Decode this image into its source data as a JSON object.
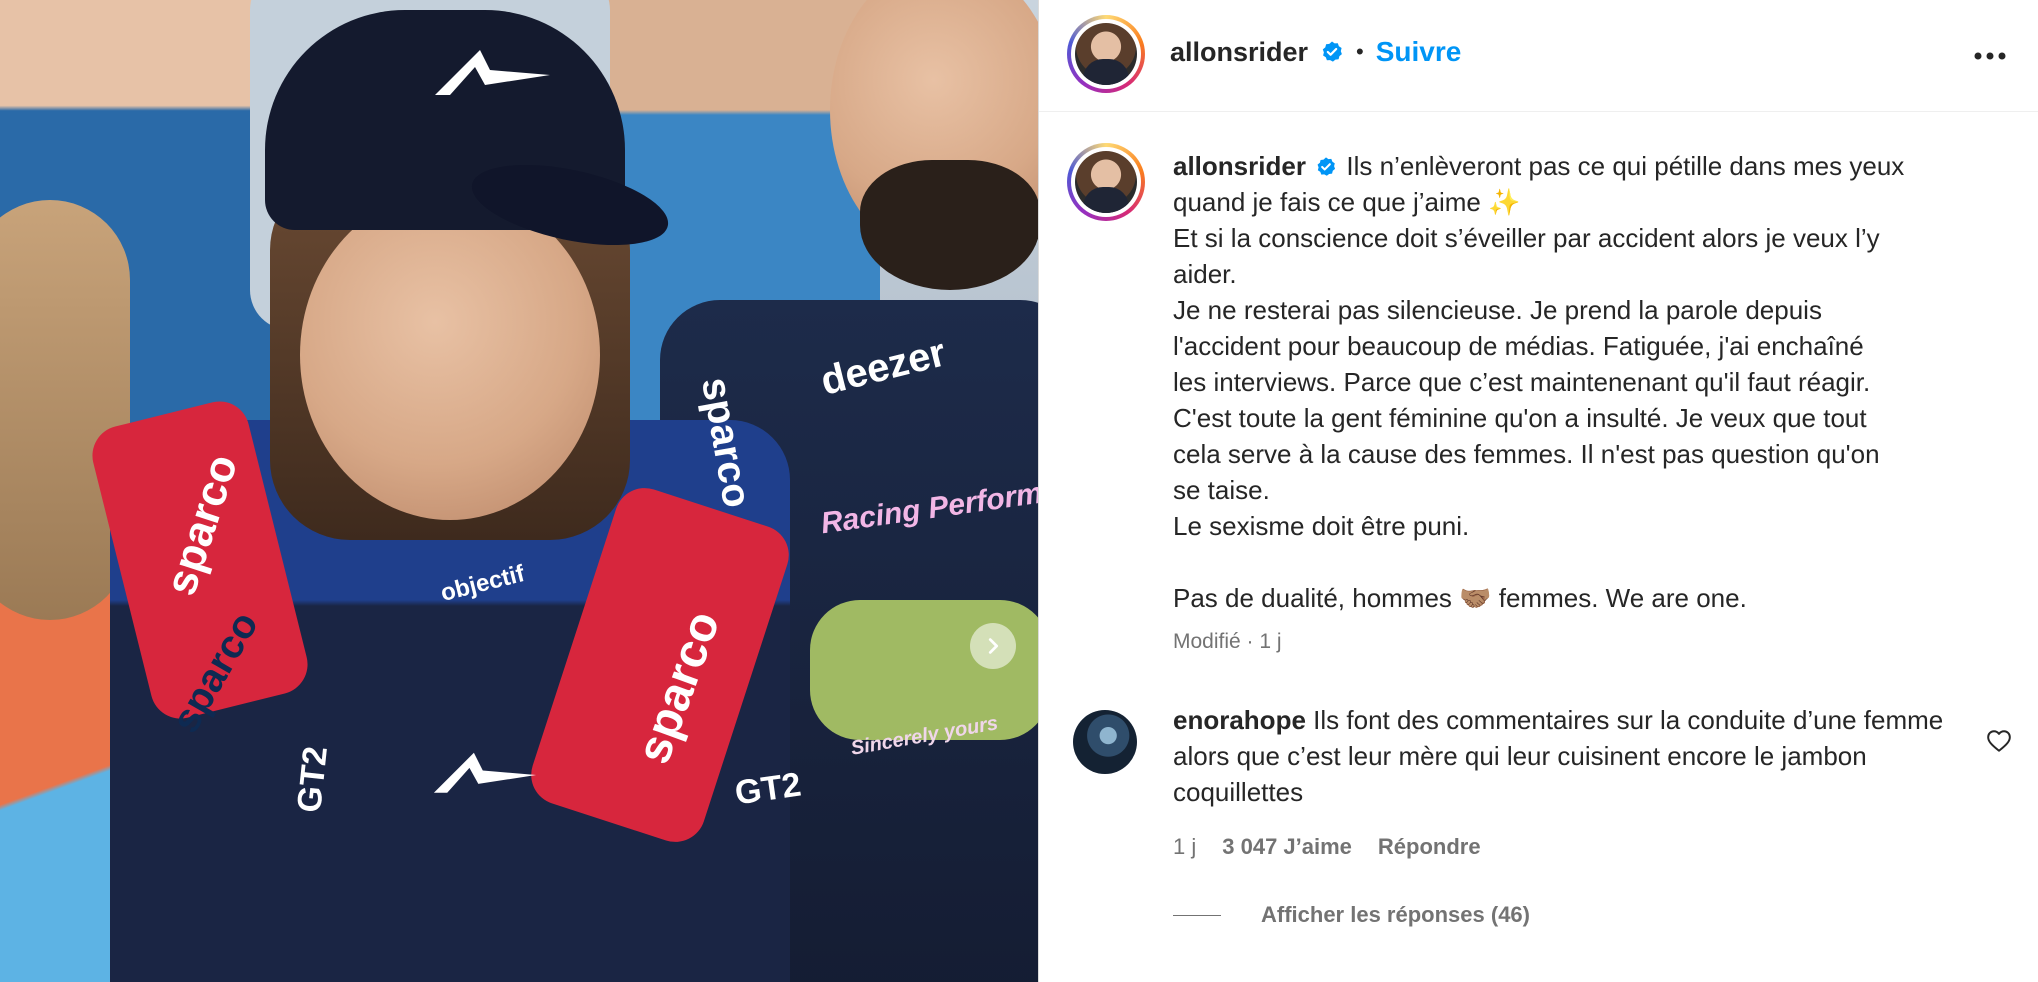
{
  "post": {
    "author": "allonsrider",
    "follow_label": "Suivre",
    "separator": "•",
    "caption_lines": [
      "Ils n’enlèveront pas ce qui pétille dans mes yeux",
      "quand je fais ce que j’aime ✨",
      "Et si la conscience doit s’éveiller par accident alors je veux l’y",
      "aider.",
      "Je ne resterai pas silencieuse. Je prend la parole depuis",
      "l'accident pour beaucoup de médias. Fatiguée, j'ai enchaîné",
      "les interviews. Parce que c’est maintenenant qu'il faut réagir.",
      "C'est toute la gent féminine qu'on a insulté. Je veux que tout",
      "cela serve à la cause des femmes. Il n'est pas question qu'on",
      "se taise.",
      "Le sexisme doit être puni.",
      "",
      "Pas de dualité, hommes 🤝🏽 femmes. We are one."
    ],
    "meta": "Modifié · 1 j"
  },
  "photo": {
    "patch_texts": [
      "sparco",
      "sparco",
      "sparco",
      "sparco",
      "deezer",
      "objectif",
      "Racing Performer",
      "GT2",
      "GT2",
      "Sincerely yours"
    ]
  },
  "comment": {
    "author": "enorahope",
    "text": "Ils font des commentaires sur la conduite d’une femme alors que c’est leur mère qui leur cuisinent encore le jambon coquillettes",
    "time": "1 j",
    "likes": "3 047 J’aime",
    "reply_label": "Répondre",
    "view_replies": "Afficher les réponses (46)"
  },
  "colors": {
    "accent": "#0095f6",
    "text": "#262626",
    "muted": "#737373"
  },
  "icons": {
    "verified": "verified-badge-icon",
    "more": "more-options-icon",
    "heart": "heart-icon",
    "next": "chevron-right-icon"
  }
}
